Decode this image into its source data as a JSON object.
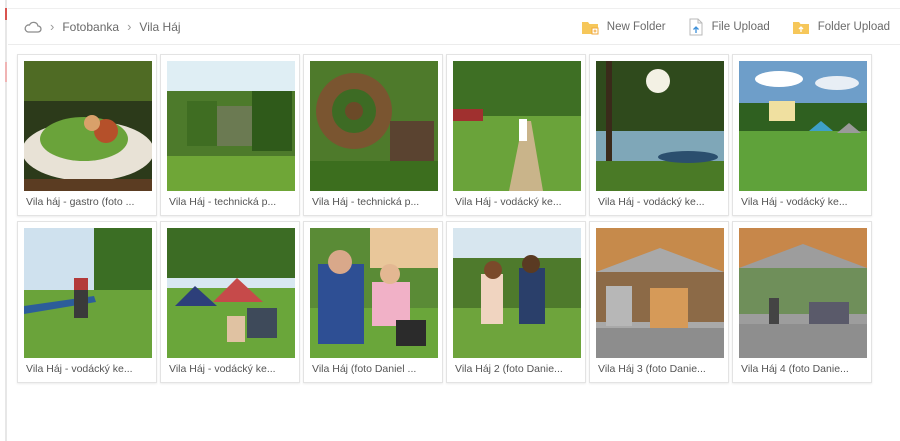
{
  "breadcrumb": {
    "items": [
      "Fotobanka",
      "Vila Háj"
    ]
  },
  "actions": {
    "new_folder": "New Folder",
    "file_upload": "File Upload",
    "folder_upload": "Folder Upload"
  },
  "colors": {
    "folder_icon": "#f6c75a",
    "separator": "#9a9a9a",
    "text": "#6a6a6a"
  },
  "files": [
    {
      "caption": "Vila háj - gastro (foto ...",
      "scene": "food"
    },
    {
      "caption": "Vila Háj - technická p...",
      "scene": "overgrown"
    },
    {
      "caption": "Vila Háj - technická p...",
      "scene": "gear"
    },
    {
      "caption": "Vila Háj - vodácký ke...",
      "scene": "path"
    },
    {
      "caption": "Vila Háj - vodácký ke...",
      "scene": "lake"
    },
    {
      "caption": "Vila Háj - vodácký ke...",
      "scene": "camp"
    },
    {
      "caption": "Vila Háj - vodácký ke...",
      "scene": "canoe"
    },
    {
      "caption": "Vila Háj - vodácký ke...",
      "scene": "tents"
    },
    {
      "caption": "Vila Háj (foto Daniel ...",
      "scene": "girls"
    },
    {
      "caption": "Vila Háj 2 (foto Danie...",
      "scene": "friends"
    },
    {
      "caption": "Vila Háj 3 (foto Danie...",
      "scene": "bar"
    },
    {
      "caption": "Vila Háj 4 (foto Danie...",
      "scene": "pavilion"
    }
  ]
}
